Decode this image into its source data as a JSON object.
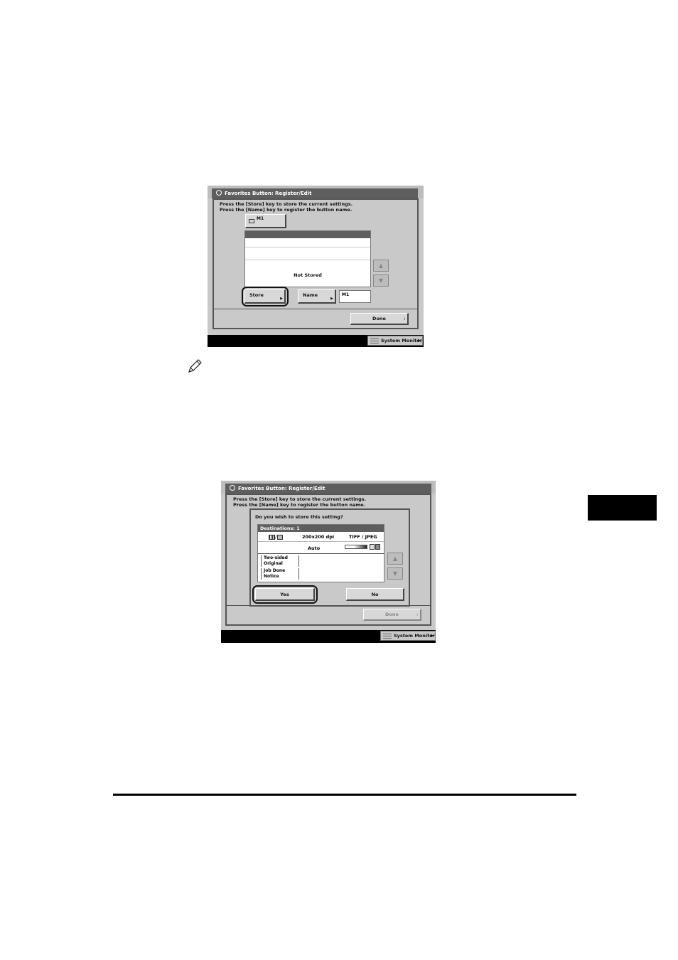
{
  "screen1": {
    "title": "Favorites Button: Register/Edit",
    "message_line1": "Press the [Store] key to store the current settings.",
    "message_line2": "Press the [Name] key to register the button name.",
    "preset_button_label": "M1",
    "list_status": "Not Stored",
    "store_label": "Store",
    "name_label": "Name",
    "name_value": "M1",
    "done_label": "Done",
    "system_monitor_label": "System Monitor"
  },
  "screen2": {
    "title": "Favorites Button: Register/Edit",
    "message_line1": "Press the [Store] key to store the current settings.",
    "message_line2": "Press the [Name] key to register the button name.",
    "dialog_question": "Do you wish to store this setting?",
    "destinations_label": "Destinations: 1",
    "resolution": "200x200 dpi",
    "file_format": "TIFF  / JPEG",
    "density": "Auto",
    "setting1_line1": "Two-sided",
    "setting1_line2": "Original",
    "setting2_line1": "Job Done",
    "setting2_line2": "Notice",
    "yes_label": "Yes",
    "no_label": "No",
    "done_label": "Done",
    "system_monitor_label": "System Monitor"
  }
}
